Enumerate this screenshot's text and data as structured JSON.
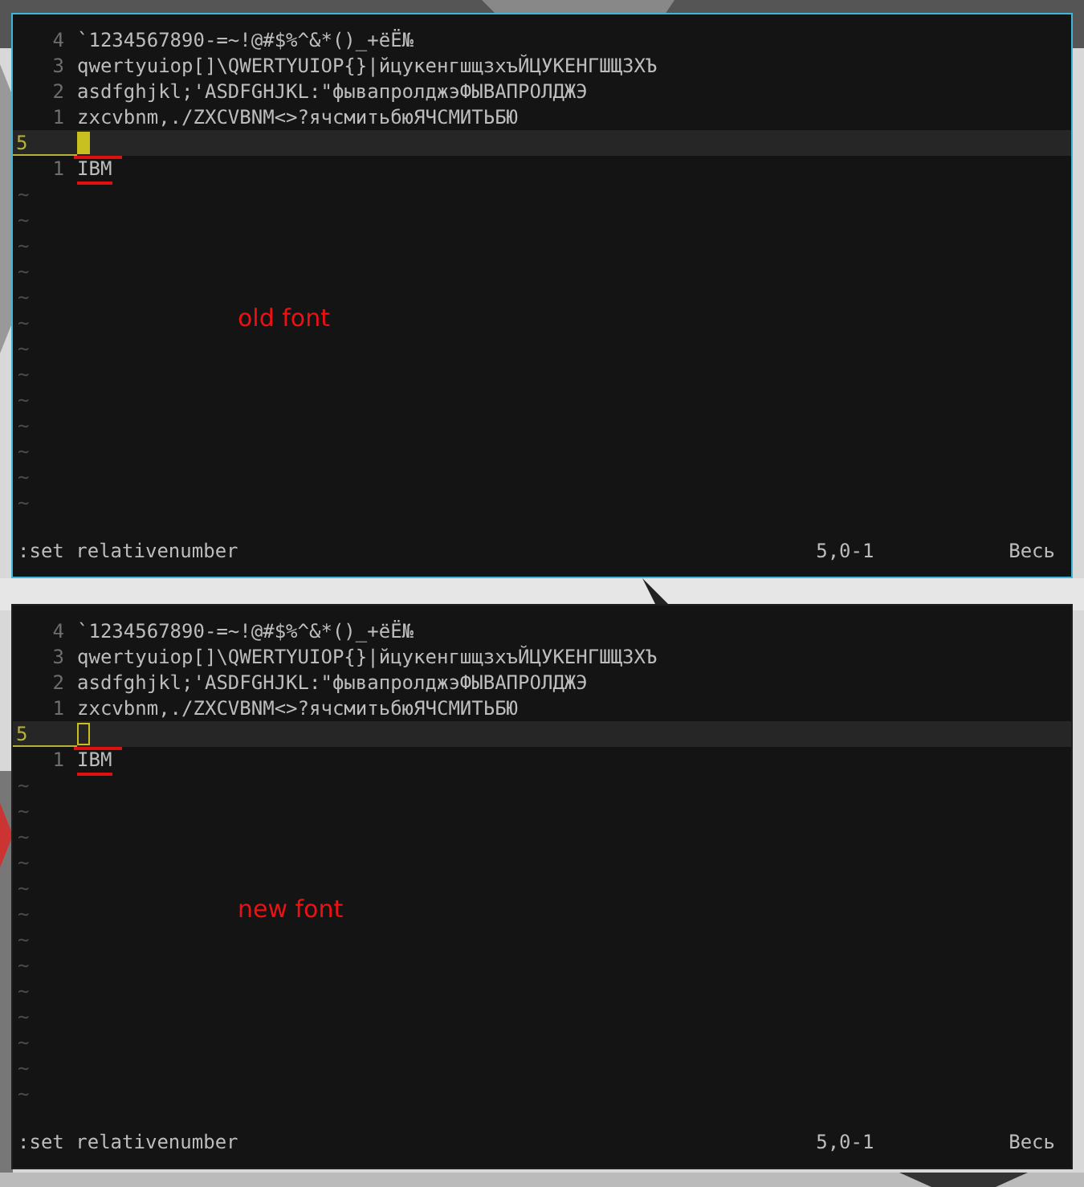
{
  "panels": [
    {
      "focused": true,
      "annotation": "old font",
      "cursor_filled": true,
      "rows": [
        {
          "number": "4",
          "text": "`1234567890-=~!@#$%^&*()_+ёЁ№",
          "current": false,
          "underlined": false
        },
        {
          "number": "3",
          "text": "qwertyuiop[]\\QWERTYUIOP{}|йцукенгшщзхъЙЦУКЕНГШЩЗХЪ",
          "current": false,
          "underlined": false
        },
        {
          "number": "2",
          "text": "asdfghjkl;'ASDFGHJKL:\"фывапролджэФЫВАПРОЛДЖЭ",
          "current": false,
          "underlined": false
        },
        {
          "number": "1",
          "text": "zxcvbnm,./ZXCVBNM<>?ячсмитьбюЯЧСМИТЬБЮ",
          "current": false,
          "underlined": false
        },
        {
          "number": "5",
          "text": "",
          "current": true,
          "underlined": true
        },
        {
          "number": "1",
          "text": "IBM",
          "current": false,
          "underlined": true
        }
      ],
      "fillers": [
        "~",
        "~",
        "~",
        "~",
        "~",
        "~",
        "~",
        "~",
        "~",
        "~",
        "~",
        "~",
        "~"
      ],
      "command": ":set relativenumber",
      "position": "5,0-1",
      "scroll": "Весь"
    },
    {
      "focused": false,
      "annotation": "new font",
      "cursor_filled": false,
      "rows": [
        {
          "number": "4",
          "text": "`1234567890-=~!@#$%^&*()_+ёЁ№",
          "current": false,
          "underlined": false
        },
        {
          "number": "3",
          "text": "qwertyuiop[]\\QWERTYUIOP{}|йцукенгшщзхъЙЦУКЕНГШЩЗХЪ",
          "current": false,
          "underlined": false
        },
        {
          "number": "2",
          "text": "asdfghjkl;'ASDFGHJKL:\"фывапролджэФЫВАПРОЛДЖЭ",
          "current": false,
          "underlined": false
        },
        {
          "number": "1",
          "text": "zxcvbnm,./ZXCVBNM<>?ячсмитьбюЯЧСМИТЬБЮ",
          "current": false,
          "underlined": false
        },
        {
          "number": "5",
          "text": "",
          "current": true,
          "underlined": true
        },
        {
          "number": "1",
          "text": "IBM",
          "current": false,
          "underlined": true
        }
      ],
      "fillers": [
        "~",
        "~",
        "~",
        "~",
        "~",
        "~",
        "~",
        "~",
        "~",
        "~",
        "~",
        "~",
        "~"
      ],
      "command": ":set relativenumber",
      "position": "5,0-1",
      "scroll": "Весь"
    }
  ]
}
